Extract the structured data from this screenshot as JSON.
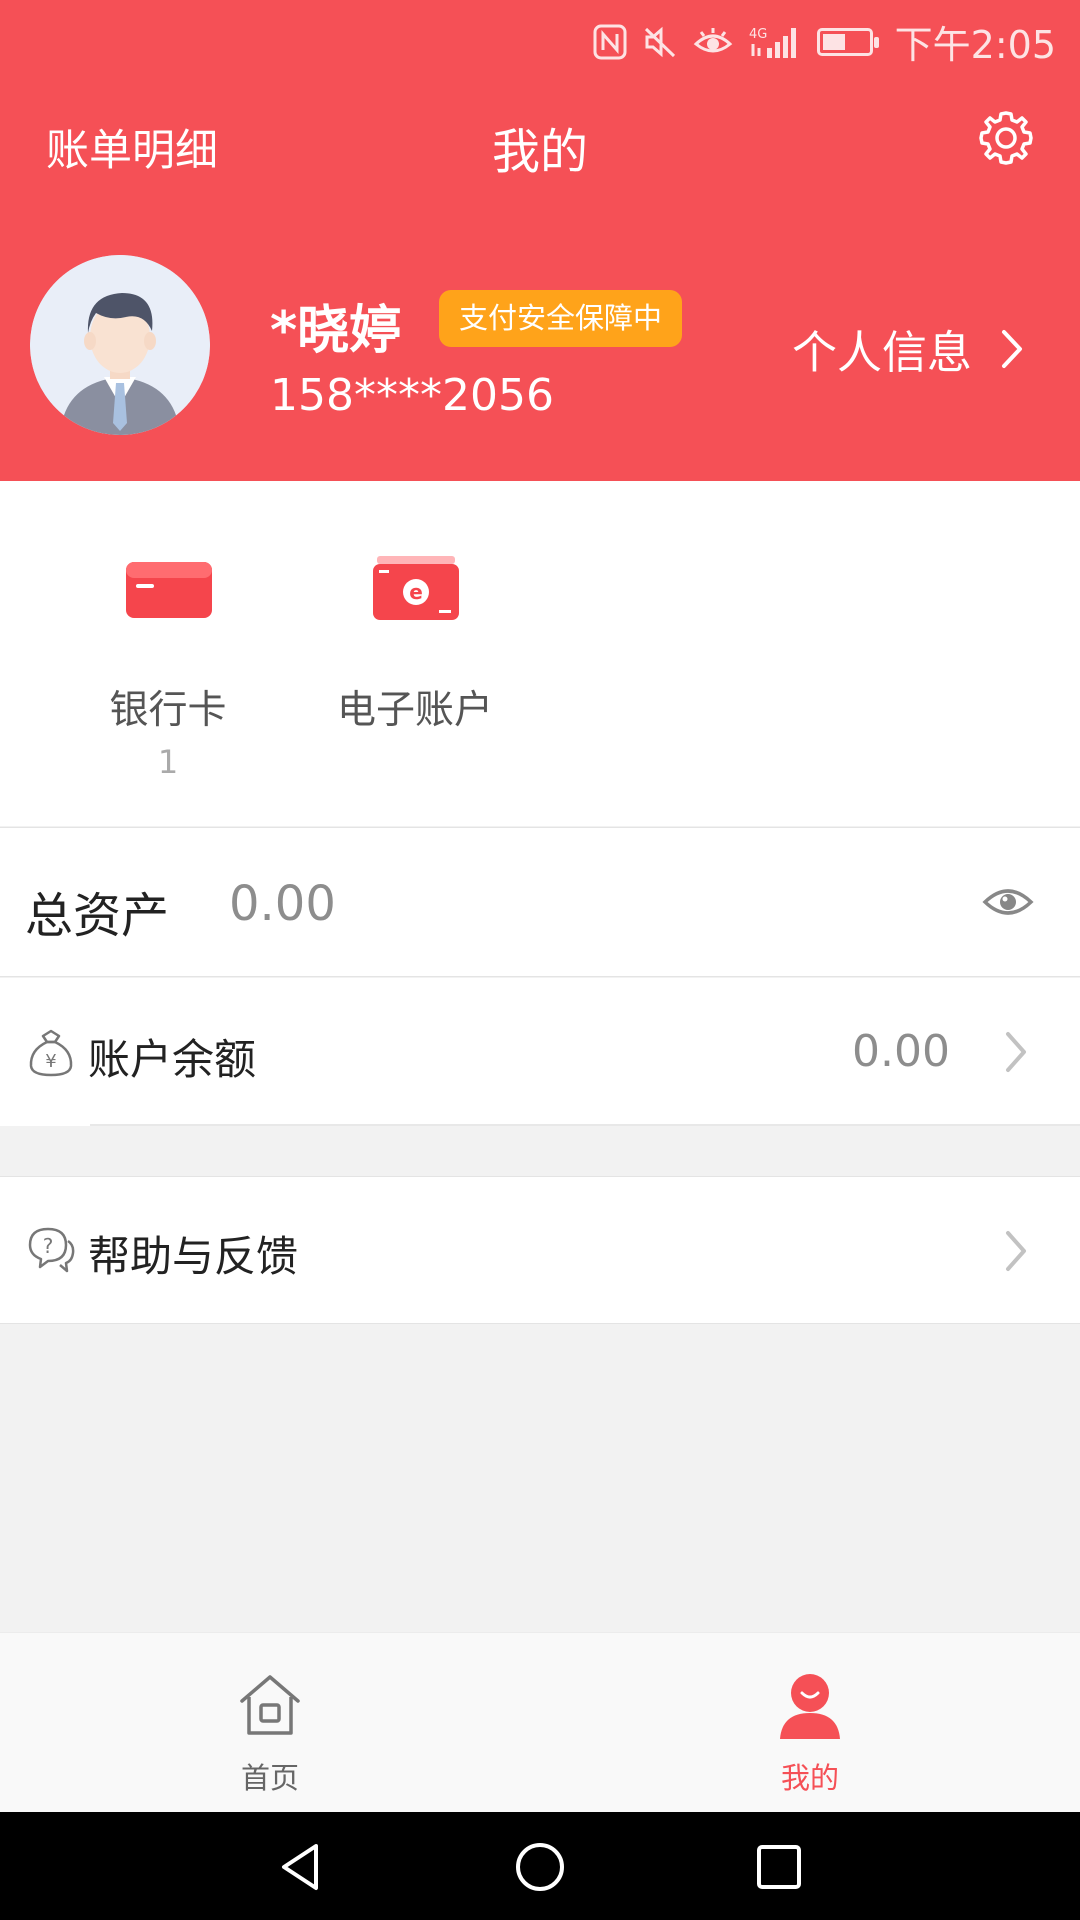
{
  "status_bar": {
    "time": "下午2:05",
    "icons": [
      "nfc-icon",
      "mute-icon",
      "eye-care-icon",
      "signal-4g-icon",
      "battery-icon"
    ]
  },
  "top_nav": {
    "left_link": "账单明细",
    "title": "我的",
    "right_icon": "gear-icon"
  },
  "profile": {
    "name": "*晓婷",
    "security_badge": "支付安全保障中",
    "phone": "158****2056",
    "info_link": "个人信息"
  },
  "quick_actions": [
    {
      "label": "银行卡",
      "count": "1",
      "icon": "bank-card-icon"
    },
    {
      "label": "电子账户",
      "count": "",
      "icon": "e-account-icon"
    }
  ],
  "assets": {
    "label": "总资产",
    "value": "0.00",
    "toggle_icon": "eye-icon"
  },
  "balance": {
    "label": "账户余额",
    "value": "0.00",
    "icon": "money-bag-icon"
  },
  "help": {
    "label": "帮助与反馈",
    "icon": "help-chat-icon"
  },
  "tab_bar": {
    "tabs": [
      {
        "label": "首页",
        "icon": "home-icon",
        "active": false
      },
      {
        "label": "我的",
        "icon": "profile-icon",
        "active": true
      }
    ]
  },
  "colors": {
    "brand_red": "#f55056",
    "badge_orange": "#ffa31a",
    "active_tab": "#f55056",
    "inactive_tab": "#666666"
  }
}
